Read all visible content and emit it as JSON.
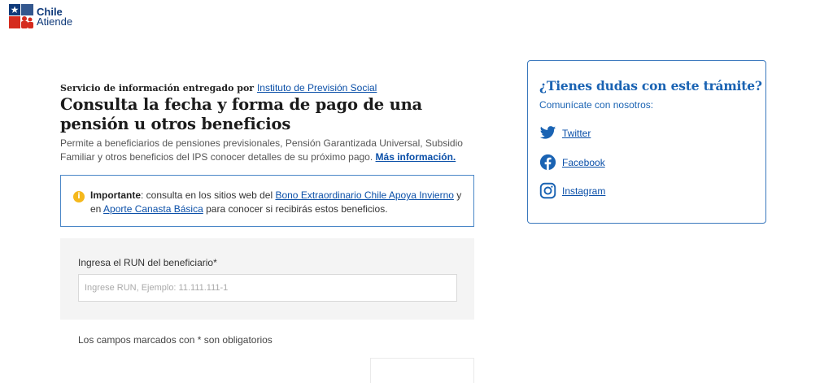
{
  "header": {
    "logo_line1": "Chile",
    "logo_line2": "Atiende"
  },
  "service": {
    "provider_prefix": "Servicio de información entregado por",
    "provider_link": "Instituto de Previsión Social",
    "title": "Consulta la fecha y forma de pago de una pensión u otros beneficios",
    "description": "Permite a beneficiarios de pensiones previsionales, Pensión Garantizada Universal, Subsidio Familiar y otros beneficios del IPS conocer detalles de su próximo pago.",
    "more_info_link": "Más información."
  },
  "notice": {
    "icon": "info-icon",
    "strong": "Importante",
    "text_before": ": consulta en los sitios web del",
    "link1": "Bono Extraordinario Chile Apoya Invierno",
    "text_middle": "y en",
    "link2": "Aporte Canasta Básica",
    "text_after": "para conocer si recibirás estos beneficios."
  },
  "form": {
    "run_label": "Ingresa el RUN del beneficiario*",
    "run_placeholder": "Ingrese RUN, Ejemplo: 11.111.111-1",
    "run_value": "",
    "required_note": "Los campos marcados con * son obligatorios"
  },
  "help": {
    "title": "¿Tienes dudas con este trámite?",
    "subtitle": "Comunícate con nosotros:",
    "links": [
      {
        "icon": "twitter-icon",
        "label": "Twitter"
      },
      {
        "icon": "facebook-icon",
        "label": "Facebook"
      },
      {
        "icon": "instagram-icon",
        "label": "Instagram"
      }
    ]
  },
  "colors": {
    "brand_blue": "#0f3a7a",
    "link_blue": "#0a4fa8",
    "help_blue": "#1a63b3",
    "notice_border": "#4a86c7",
    "warning_yellow": "#f5b81c",
    "chile_red": "#d52b1e"
  }
}
